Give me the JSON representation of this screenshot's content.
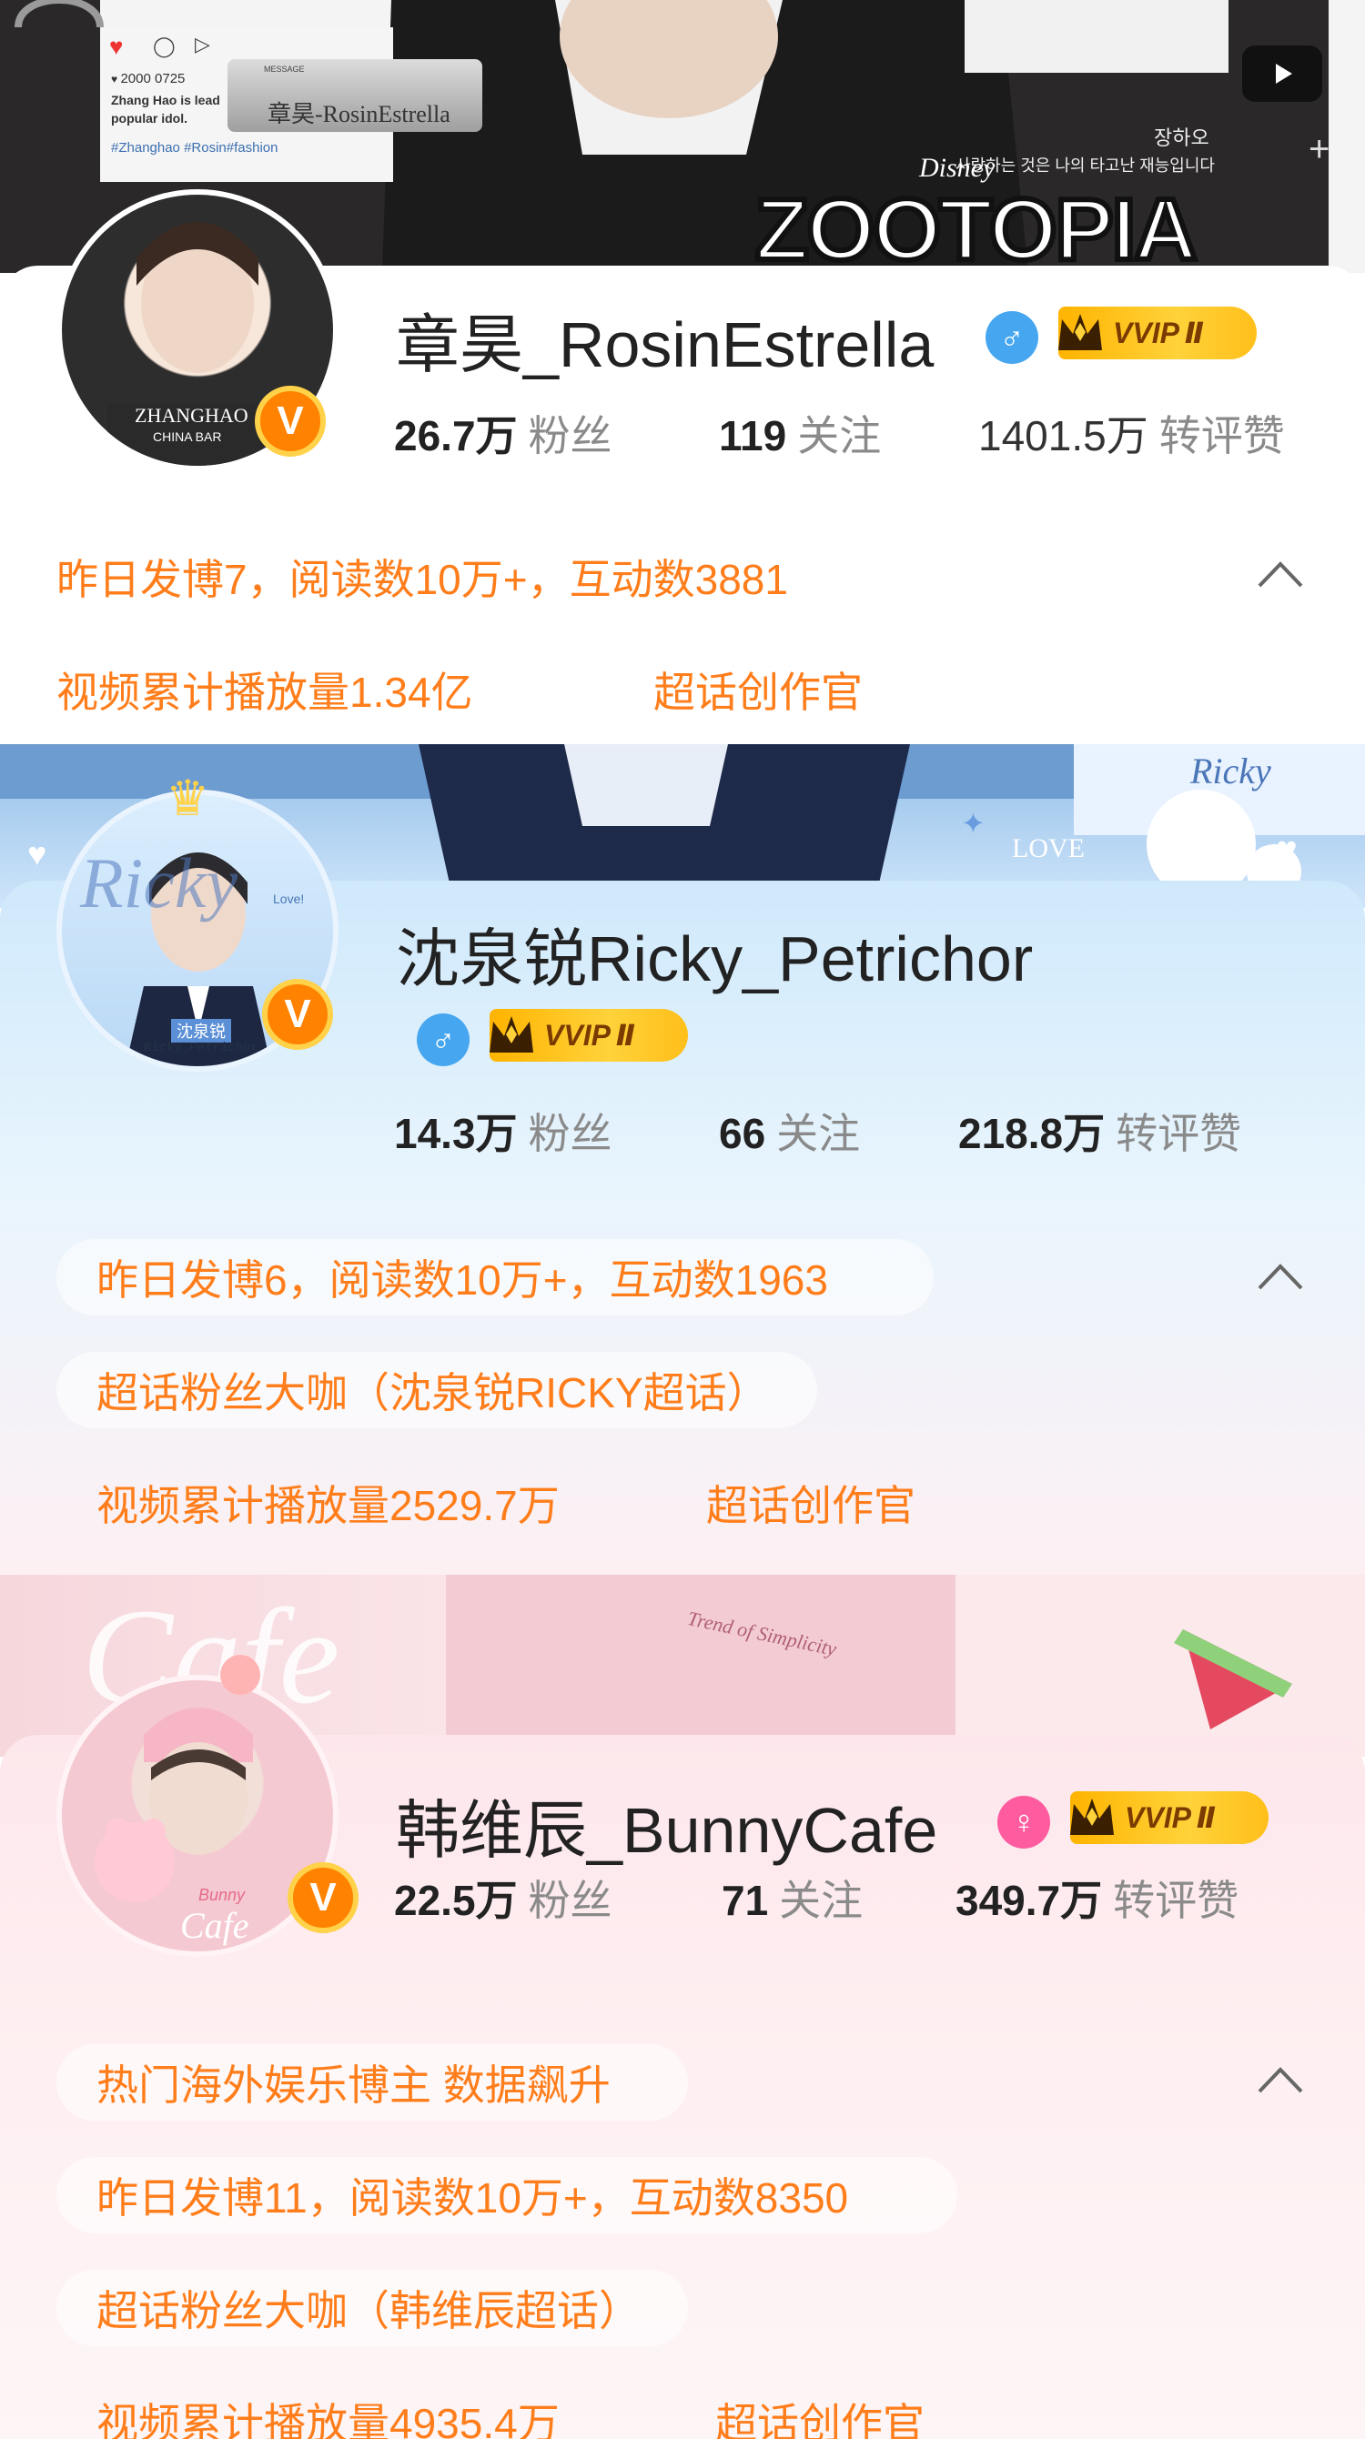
{
  "colors": {
    "accent_orange": "#ff7d1a",
    "verified_badge": "#ff8200",
    "male_icon": "#46a6f0",
    "female_icon": "#ff5ca0",
    "vvip_gold": "#ffc21a"
  },
  "profiles": [
    {
      "banner": {
        "post_date": "2000 0725",
        "post_text_1": "Zhang Hao is lead",
        "post_text_2": "popular idol.",
        "hashtags": "#Zhanghao #Rosin#fashion",
        "message_label": "MESSAGE",
        "message_name": "章昊-RosinEstrella",
        "korean_name": "장하오",
        "korean_line": "사랑하는 것은 나의 타고난 재능입니다",
        "logo_small": "Disney",
        "logo_big": "ZOOTOPIA",
        "avatar_caption": "ZHANGHAO",
        "avatar_caption_2": "CHINA BAR"
      },
      "name": "章昊_RosinEstrella",
      "gender": "male",
      "gender_icon": "male-icon",
      "vvip": "VVIP",
      "vvip_level": "Ⅱ",
      "stats": [
        {
          "num": "26.7万",
          "label": "粉丝"
        },
        {
          "num": "119",
          "label": "关注"
        },
        {
          "num": "1401.5万",
          "label": "转评赞"
        }
      ],
      "tags": [
        "昨日发博7，阅读数10万+，互动数3881",
        "视频累计播放量1.34亿",
        "超话创作官"
      ]
    },
    {
      "banner": {
        "text_1": "Ricky",
        "text_2": "LOVE",
        "avatar_text": "Ricky",
        "avatar_caption": "沈泉锐",
        "avatar_caption_2": "Ricky_Petrichor",
        "sticker_text": "Love!"
      },
      "name": "沈泉锐Ricky_Petrichor",
      "gender": "male",
      "gender_icon": "male-icon",
      "vvip": "VVIP",
      "vvip_level": "Ⅱ",
      "stats": [
        {
          "num": "14.3万",
          "label": "粉丝"
        },
        {
          "num": "66",
          "label": "关注"
        },
        {
          "num": "218.8万",
          "label": "转评赞"
        }
      ],
      "tags": [
        "昨日发博6，阅读数10万+，互动数1963",
        "超话粉丝大咖（沈泉锐RICKY超话）",
        "视频累计播放量2529.7万",
        "超话创作官"
      ]
    },
    {
      "banner": {
        "text_1": "Cafe",
        "text_2": "Trend of Simplicity",
        "avatar_caption": "Bunny",
        "avatar_caption_2": "Cafe"
      },
      "name": "韩维辰_BunnyCafe",
      "gender": "female",
      "gender_icon": "female-icon",
      "vvip": "VVIP",
      "vvip_level": "Ⅱ",
      "stats": [
        {
          "num": "22.5万",
          "label": "粉丝"
        },
        {
          "num": "71",
          "label": "关注"
        },
        {
          "num": "349.7万",
          "label": "转评赞"
        }
      ],
      "tags": [
        "热门海外娱乐博主 数据飙升",
        "昨日发博11，阅读数10万+，互动数8350",
        "超话粉丝大咖（韩维辰超话）",
        "视频累计播放量4935.4万",
        "超话创作官"
      ]
    }
  ]
}
